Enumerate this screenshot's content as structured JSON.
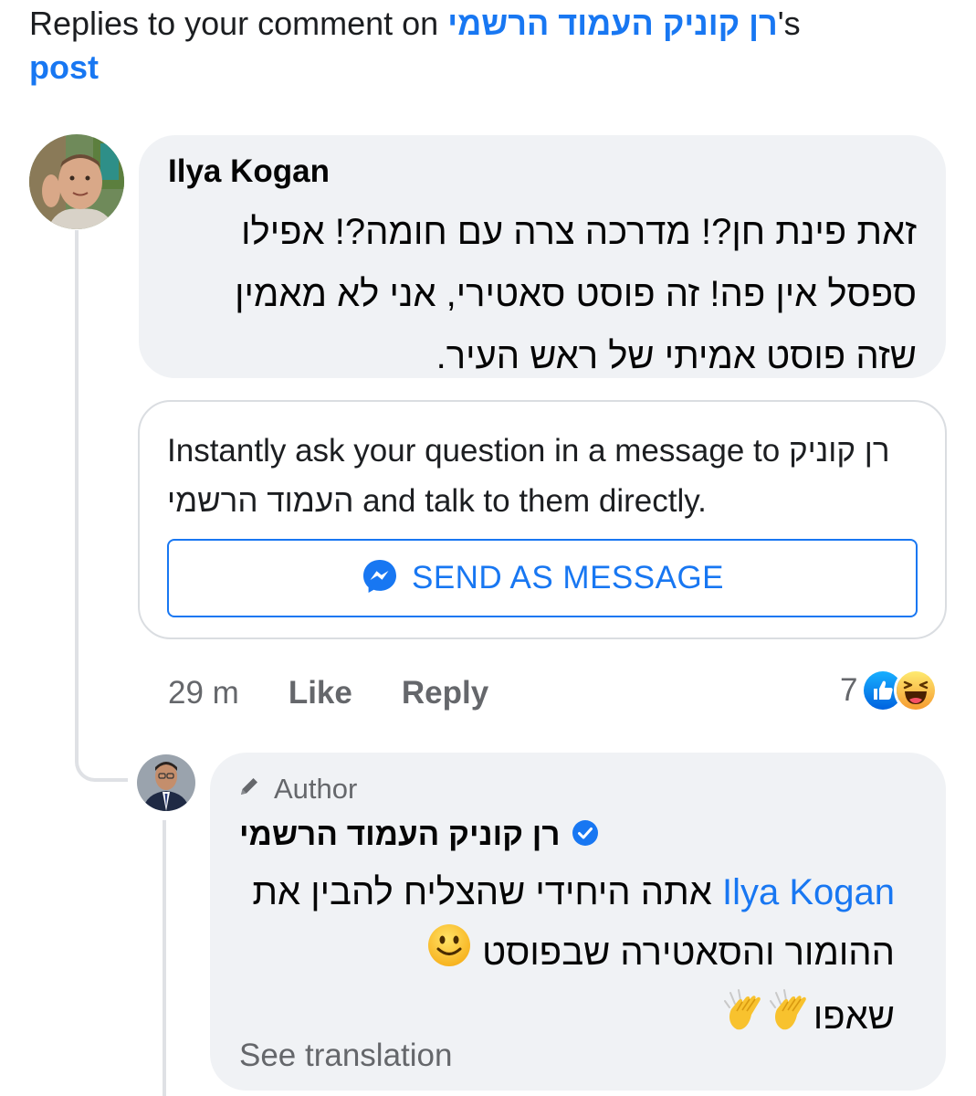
{
  "header": {
    "prefix": "Replies to your comment on ",
    "page_name": "רן קוניק העמוד הרשמי",
    "possessive": "'s",
    "post_link": "post"
  },
  "comment": {
    "author": "Ilya Kogan",
    "text": "זאת פינת חן?! מדרכה צרה עם חומה?! אפילו ספסל אין פה! זה פוסט סאטירי, אני לא מאמין שזה פוסט אמיתי של ראש העיר.",
    "time": "29 m",
    "like_label": "Like",
    "reply_label": "Reply",
    "reaction_count": "7",
    "reaction_icons": [
      "like-reaction",
      "haha-reaction"
    ]
  },
  "message_prompt": {
    "text_prefix": "Instantly ask your question in a message to ",
    "page_name": "רן קוניק העמוד הרשמי",
    "text_suffix": " and talk to them directly.",
    "button_label": "SEND AS MESSAGE",
    "button_icon": "messenger-icon"
  },
  "reply": {
    "badge": "Author",
    "author": "רן קוניק העמוד הרשמי",
    "verified_icon": "verified-badge-icon",
    "mention": "Ilya Kogan",
    "text_part1": " אתה היחידי שהצליח להבין את ההומור והסאטירה שבפוסט ",
    "text_part2": " שאפו",
    "emojis": [
      "slightly-smiling-face-icon",
      "clapping-hands-icon",
      "clapping-hands-icon"
    ],
    "see_translation": "See translation"
  },
  "colors": {
    "link_blue": "#1877f2",
    "bubble_bg": "#f0f2f5",
    "secondary_text": "#65676b",
    "thread_line": "#dfe1e5"
  }
}
